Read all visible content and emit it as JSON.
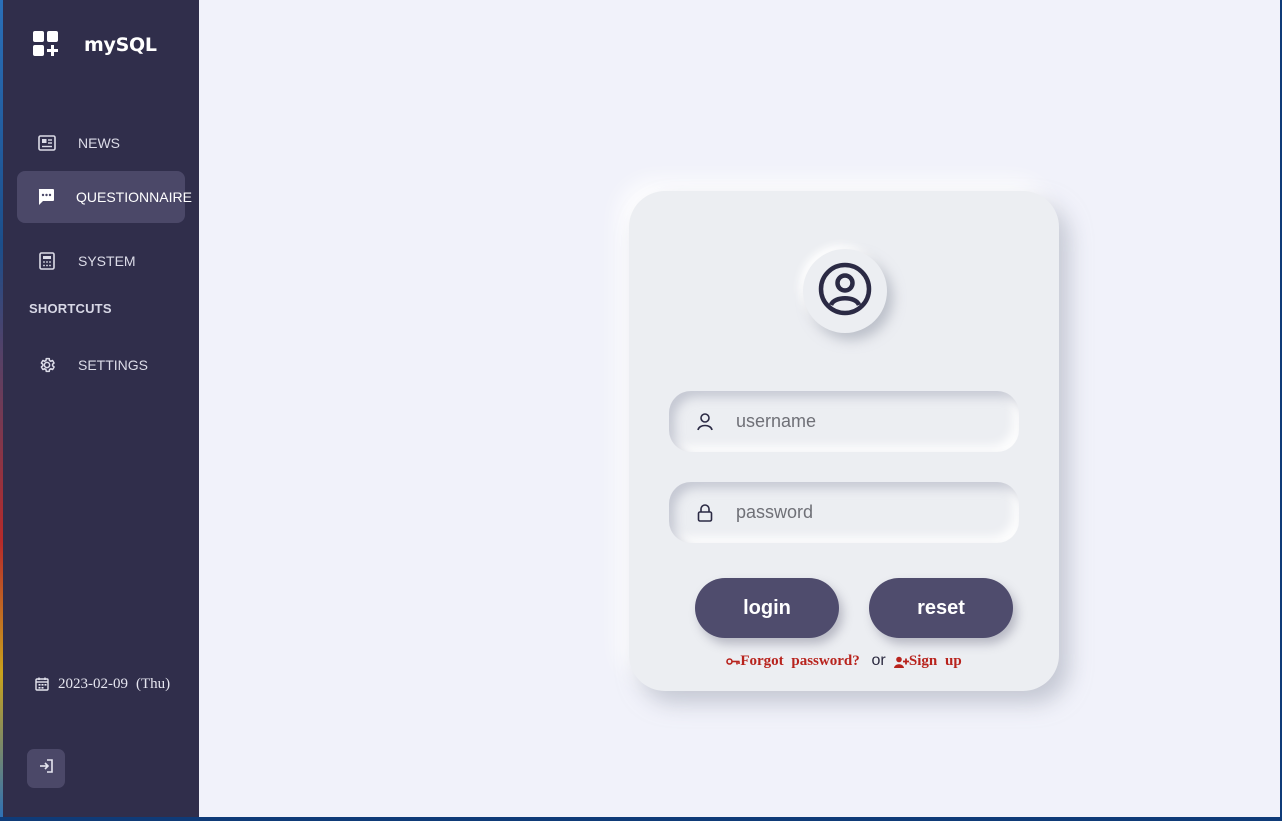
{
  "brand": {
    "name": "mySQL",
    "icon": "apps-plus-icon"
  },
  "sidebar": {
    "items": [
      {
        "label": "NEWS",
        "icon": "newspaper-icon",
        "active": false
      },
      {
        "label": "QUESTIONNAIRE",
        "icon": "chat-bubble-icon",
        "active": true
      },
      {
        "label": "SYSTEM",
        "icon": "calculator-icon",
        "active": false
      }
    ],
    "section_label": "SHORTCUTS",
    "shortcuts": [
      {
        "label": "SETTINGS",
        "icon": "gear-icon"
      }
    ],
    "date": "2023-02-09",
    "weekday": "(Thu)",
    "logout_icon": "sign-in-icon"
  },
  "login": {
    "username_placeholder": "username",
    "password_placeholder": "password",
    "login_label": "login",
    "reset_label": "reset",
    "forgot_label": "Forgot password?",
    "or_label": "or",
    "signup_label": "Sign up"
  },
  "colors": {
    "sidebar_bg": "#302e4b",
    "active_item_bg": "#4b4868",
    "main_bg": "#f1f2fa",
    "card_bg": "#eceef2",
    "button_bg": "#4f4c6d",
    "link_color": "#b8231d"
  }
}
